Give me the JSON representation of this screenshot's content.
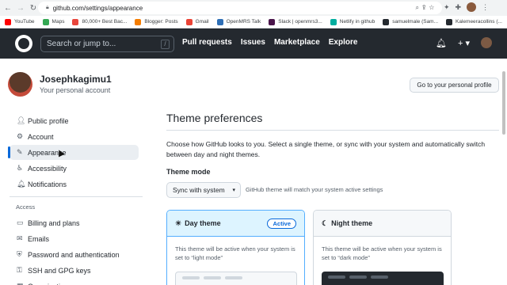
{
  "browser": {
    "url_host": "github.com",
    "url_path": "/settings/appearance",
    "bookmarks": [
      {
        "label": "YouTube",
        "color": "#ff0000"
      },
      {
        "label": "Maps",
        "color": "#34a853"
      },
      {
        "label": "80,000+ Best Bac...",
        "color": "#e8453c"
      },
      {
        "label": "Blogger: Posts",
        "color": "#f57d00"
      },
      {
        "label": "Gmail",
        "color": "#ea4335"
      },
      {
        "label": "OpenMRS Talk",
        "color": "#2f6fb6"
      },
      {
        "label": "Slack | openmrs3...",
        "color": "#4a154b"
      },
      {
        "label": "Netlify in github",
        "color": "#00ad9f"
      },
      {
        "label": "samuelmale (Sam...",
        "color": "#24292f"
      },
      {
        "label": "Kalemeeracollins (...",
        "color": "#24292f"
      }
    ]
  },
  "header": {
    "search_placeholder": "Search or jump to...",
    "search_shortcut": "/",
    "nav": [
      "Pull requests",
      "Issues",
      "Marketplace",
      "Explore"
    ],
    "plus": "+ ▾",
    "bell": "🔔︎"
  },
  "profile": {
    "username": "Josephkagimu1",
    "subtitle": "Your personal account",
    "goto_button": "Go to your personal profile"
  },
  "sidebar": {
    "items": [
      {
        "label": "Public profile",
        "icon": "person-icon",
        "glyph": "👤︎"
      },
      {
        "label": "Account",
        "icon": "gear-icon",
        "glyph": "⚙"
      },
      {
        "label": "Appearance",
        "icon": "paintbrush-icon",
        "glyph": "✎"
      },
      {
        "label": "Accessibility",
        "icon": "accessibility-icon",
        "glyph": "♿︎"
      },
      {
        "label": "Notifications",
        "icon": "bell-icon",
        "glyph": "🔔︎"
      }
    ],
    "section_access": "Access",
    "access_items": [
      {
        "label": "Billing and plans",
        "icon": "credit-card-icon",
        "glyph": "▭"
      },
      {
        "label": "Emails",
        "icon": "mail-icon",
        "glyph": "✉"
      },
      {
        "label": "Password and authentication",
        "icon": "shield-lock-icon",
        "glyph": "⛨"
      },
      {
        "label": "SSH and GPG keys",
        "icon": "key-icon",
        "glyph": "⚿"
      },
      {
        "label": "Organizations",
        "icon": "organization-icon",
        "glyph": "▦"
      }
    ]
  },
  "main": {
    "title": "Theme preferences",
    "description": "Choose how GitHub looks to you. Select a single theme, or sync with your system and automatically switch between day and night themes.",
    "theme_mode_label": "Theme mode",
    "theme_mode_value": "Sync with system",
    "theme_mode_note": "GitHub theme will match your system active settings",
    "day_card": {
      "title": "Day theme",
      "badge": "Active",
      "body": "This theme will be active when your system is set to “light mode”"
    },
    "night_card": {
      "title": "Night theme",
      "body": "This theme will be active when your system is set to “dark mode”"
    }
  }
}
